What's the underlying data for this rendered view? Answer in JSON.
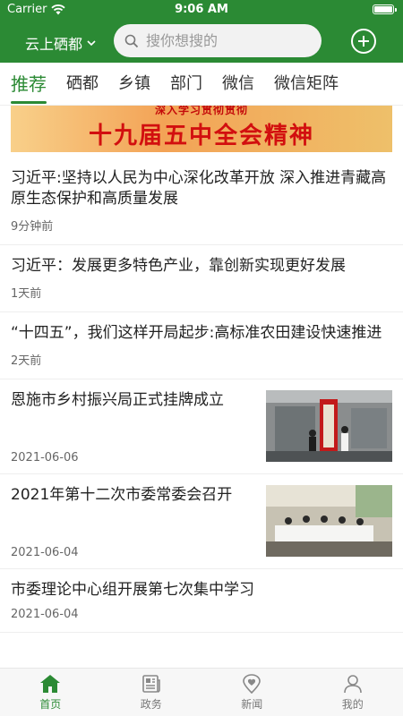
{
  "status_bar": {
    "carrier": "Carrier",
    "time": "9:06 AM"
  },
  "header": {
    "city": "云上硒都",
    "search_placeholder": "搜你想搜的"
  },
  "tabs": [
    {
      "label": "推荐",
      "active": true
    },
    {
      "label": "硒都",
      "active": false
    },
    {
      "label": "乡镇",
      "active": false
    },
    {
      "label": "部门",
      "active": false
    },
    {
      "label": "微信",
      "active": false
    },
    {
      "label": "微信矩阵",
      "active": false
    }
  ],
  "banner": {
    "subtitle": "深入学习贯彻贯彻",
    "title": "十九届五中全会精神"
  },
  "news": [
    {
      "title": "习近平:坚持以人民为中心深化改革开放 深入推进青藏高原生态保护和高质量发展",
      "time": "9分钟前"
    },
    {
      "title": "习近平：发展更多特色产业，靠创新实现更好发展",
      "time": "1天前"
    },
    {
      "title": "“十四五”，我们这样开局起步:高标准农田建设快速推进",
      "time": "2天前"
    },
    {
      "title": "恩施市乡村振兴局正式挂牌成立",
      "time": "2021-06-06",
      "image": "ceremony-photo"
    },
    {
      "title": "2021年第十二次市委常委会召开",
      "time": "2021-06-04",
      "image": "meeting-photo"
    },
    {
      "title": "市委理论中心组开展第七次集中学习",
      "time": "2021-06-04"
    }
  ],
  "bottom_nav": [
    {
      "label": "首页",
      "icon": "home-icon",
      "active": true
    },
    {
      "label": "政务",
      "icon": "newspaper-icon",
      "active": false
    },
    {
      "label": "新闻",
      "icon": "location-heart-icon",
      "active": false
    },
    {
      "label": "我的",
      "icon": "user-icon",
      "active": false
    }
  ],
  "colors": {
    "brand_green": "#2b8a34",
    "banner_red": "#d20f0f"
  }
}
